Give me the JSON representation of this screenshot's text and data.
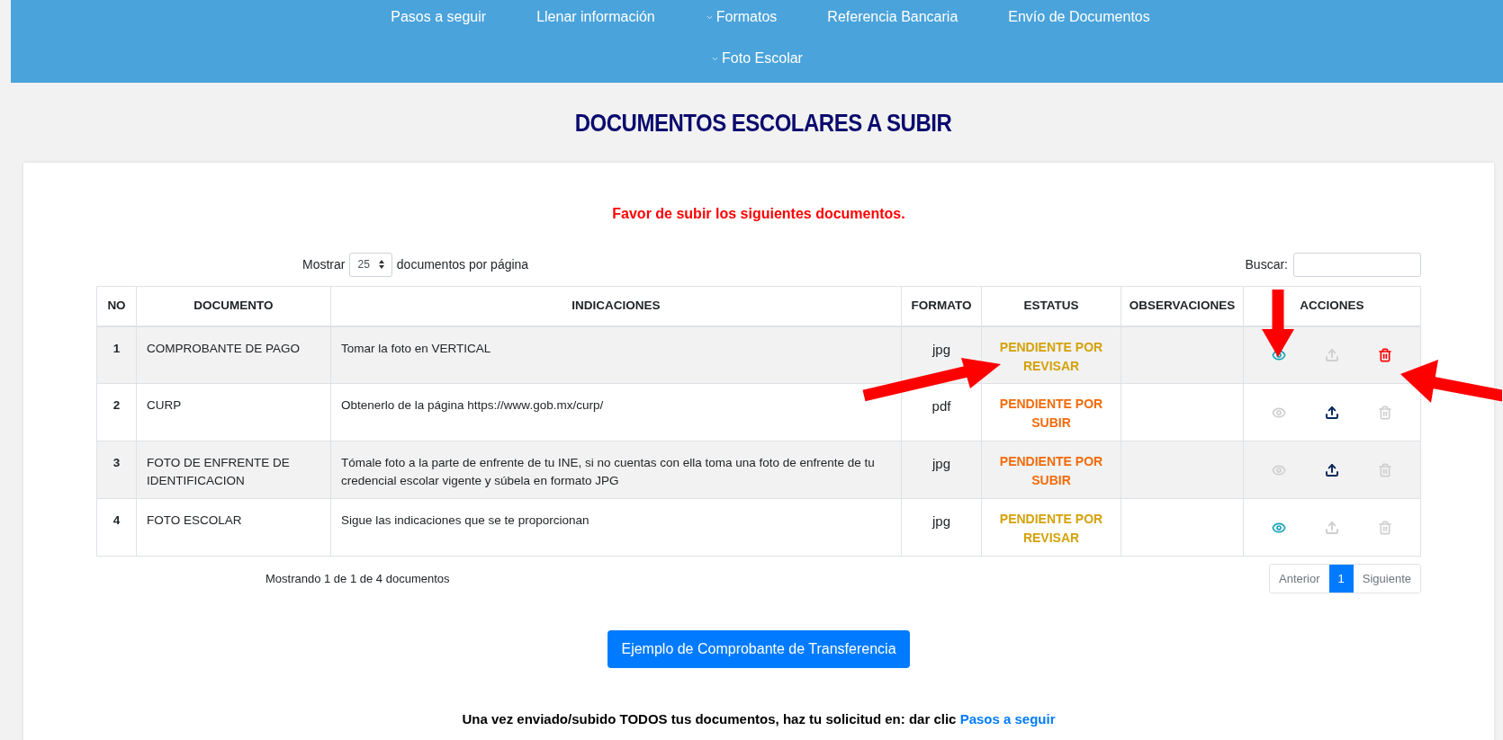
{
  "nav": {
    "items": [
      {
        "label": "Pasos a seguir",
        "dropdown": false
      },
      {
        "label": "Llenar información",
        "dropdown": false
      },
      {
        "label": "Formatos",
        "dropdown": true
      },
      {
        "label": "Referencia Bancaria",
        "dropdown": false
      },
      {
        "label": "Envío de Documentos",
        "dropdown": false
      },
      {
        "label": "Foto Escolar",
        "dropdown": true
      }
    ]
  },
  "title": "DOCUMENTOS ESCOLARES A SUBIR",
  "notice": "Favor de subir los siguientes documentos.",
  "length_control": {
    "before": "Mostrar",
    "value": "25",
    "after": "documentos por página"
  },
  "search": {
    "label": "Buscar:"
  },
  "table": {
    "columns": [
      "NO",
      "DOCUMENTO",
      "INDICACIONES",
      "FORMATO",
      "ESTATUS",
      "OBSERVACIONES",
      "ACCIONES"
    ],
    "rows": [
      {
        "no": "1",
        "documento": "COMPROBANTE DE PAGO",
        "indicaciones": "Tomar la foto en VERTICAL",
        "formato": "jpg",
        "estatus": {
          "kind": "review",
          "text": "PENDIENTE POR REVISAR"
        },
        "actions": [
          {
            "kind": "view",
            "enabled": true
          },
          {
            "kind": "upload",
            "enabled": false
          },
          {
            "kind": "delete",
            "enabled": true
          }
        ]
      },
      {
        "no": "2",
        "documento": "CURP",
        "indicaciones": "Obtenerlo de la página https://www.gob.mx/curp/",
        "formato": "pdf",
        "estatus": {
          "kind": "upload",
          "text": "PENDIENTE POR SUBIR"
        },
        "actions": [
          {
            "kind": "view",
            "enabled": false
          },
          {
            "kind": "upload",
            "enabled": true
          },
          {
            "kind": "delete",
            "enabled": false
          }
        ]
      },
      {
        "no": "3",
        "documento": "FOTO DE ENFRENTE DE IDENTIFICACION",
        "indicaciones": "Tómale foto a la parte de enfrente de tu INE, si no cuentas con ella toma una foto de enfrente de tu credencial escolar vigente y súbela en formato JPG",
        "formato": "jpg",
        "estatus": {
          "kind": "upload",
          "text": "PENDIENTE POR SUBIR"
        },
        "actions": [
          {
            "kind": "view",
            "enabled": false
          },
          {
            "kind": "upload",
            "enabled": true
          },
          {
            "kind": "delete",
            "enabled": false
          }
        ]
      },
      {
        "no": "4",
        "documento": "FOTO ESCOLAR",
        "indicaciones": "Sigue las indicaciones que se te proporcionan",
        "formato": "jpg",
        "estatus": {
          "kind": "review",
          "text": "PENDIENTE POR REVISAR"
        },
        "actions": [
          {
            "kind": "view",
            "enabled": true
          },
          {
            "kind": "upload",
            "enabled": false
          },
          {
            "kind": "delete",
            "enabled": false
          }
        ]
      }
    ]
  },
  "info": "Mostrando 1 de 1 de 4 documentos",
  "pagination": [
    {
      "label": "Anterior",
      "selected": false
    },
    {
      "label": "1",
      "selected": true
    },
    {
      "label": "Siguiente",
      "selected": false
    }
  ],
  "example_button": "Ejemplo de Comprobante de Transferencia",
  "footer": {
    "text": "Una vez enviado/subido TODOS tus documentos, haz tu solicitud en: dar clic",
    "link": "Pasos a seguir"
  }
}
